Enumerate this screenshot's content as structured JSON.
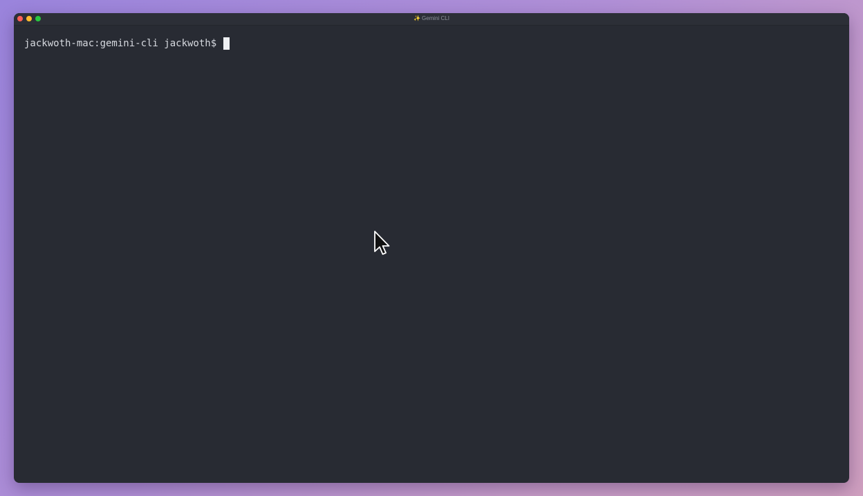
{
  "window": {
    "title": "Gemini CLI",
    "title_icon": "sparkles-icon",
    "title_icon_glyph": "✨",
    "traffic_lights": {
      "close_color": "#ff5f57",
      "minimize_color": "#febc2e",
      "zoom_color": "#28c840"
    }
  },
  "terminal": {
    "prompt": "jackwoth-mac:gemini-cli jackwoth$",
    "background": "#282b33",
    "foreground": "#d7dae0"
  },
  "pointer": {
    "icon": "mouse-pointer-icon"
  }
}
